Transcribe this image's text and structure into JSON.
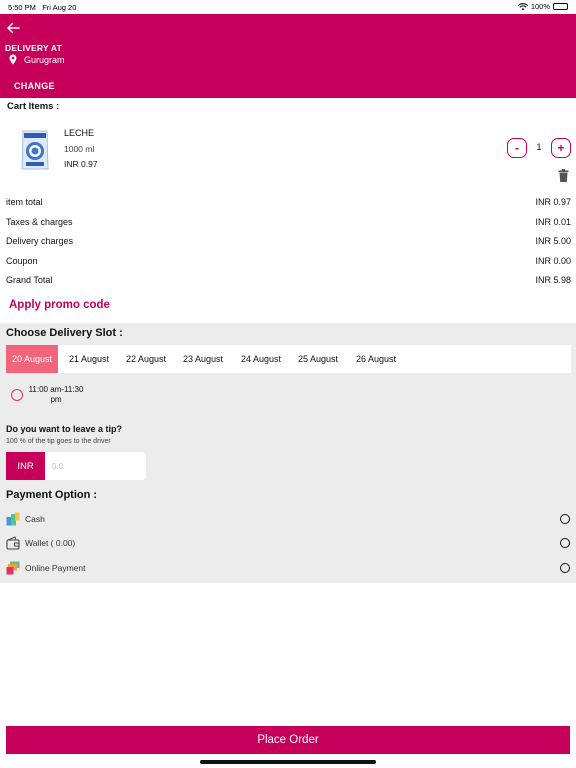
{
  "status_bar": {
    "time": "5:50 PM",
    "date": "Fri Aug 20",
    "battery": "100%"
  },
  "header": {
    "delivery_label": "DELIVERY AT",
    "location": "Gurugram",
    "change_label": "CHANGE"
  },
  "cart": {
    "label": "Cart Items :",
    "item": {
      "name": "LECHE",
      "size": "1000 ml",
      "price": "INR 0.97",
      "quantity": "1",
      "minus": "-",
      "plus": "+"
    }
  },
  "summary": [
    {
      "label": "item total",
      "value": "INR 0.97"
    },
    {
      "label": "Taxes & charges",
      "value": "INR 0.01"
    },
    {
      "label": "Delivery charges",
      "value": "INR 5.00"
    },
    {
      "label": "Coupon",
      "value": "INR 0.00"
    },
    {
      "label": "Grand Total",
      "value": "INR 5.98"
    }
  ],
  "promo_label": "Apply promo code",
  "delivery_slot": {
    "title": "Choose Delivery Slot :",
    "dates": [
      "20 August",
      "21 August",
      "22 August",
      "23 August",
      "24 August",
      "25 August",
      "26 August"
    ],
    "selected_date": "20 August",
    "time_slot": "11:00 am-11:30 pm"
  },
  "tip": {
    "title": "Do you want to leave a tip?",
    "subtitle": "100 % of the tip goes to the driver",
    "currency": "INR",
    "placeholder": "0.0"
  },
  "payment": {
    "title": "Payment Option :",
    "options": [
      {
        "label": "Cash",
        "icon": "cash-icon"
      },
      {
        "label": "Wallet ( 0.00)",
        "icon": "wallet-icon"
      },
      {
        "label": "Online Payment",
        "icon": "online-payment-icon"
      }
    ]
  },
  "place_order_label": "Place Order",
  "colors": {
    "brand": "#c6005a",
    "selected_date": "#f2647a",
    "section_bg": "#ececec"
  }
}
